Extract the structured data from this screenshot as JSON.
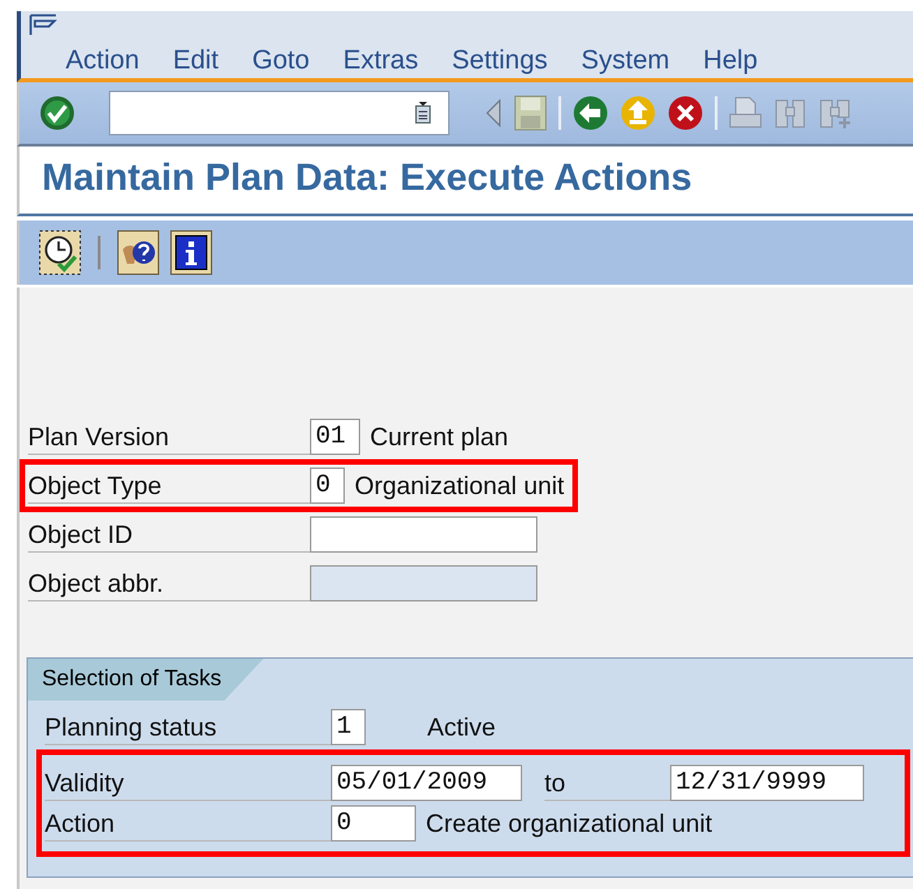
{
  "menu": [
    "Action",
    "Edit",
    "Goto",
    "Extras",
    "Settings",
    "System",
    "Help"
  ],
  "title": "Maintain Plan Data: Execute Actions",
  "fields": [
    {
      "label": "Plan Version",
      "kind": "code",
      "value": "01",
      "description": "Current plan",
      "highlighted": false
    },
    {
      "label": "Object Type",
      "kind": "code",
      "value": "0",
      "description": "Organizational unit",
      "highlighted": true
    },
    {
      "label": "Object ID",
      "kind": "text",
      "highlighted": false
    },
    {
      "label": "Object abbr.",
      "kind": "readonly",
      "highlighted": false
    }
  ],
  "tasks": {
    "title": "Selection of Tasks",
    "rows": [
      {
        "label": "Planning status",
        "kind": "code",
        "value": "1",
        "description": "Active",
        "highlighted": false
      },
      {
        "label": "Validity",
        "kind": "range",
        "value": "05/01/2009",
        "to_label": "to",
        "value_to": "12/31/9999",
        "highlighted": true
      },
      {
        "label": "Action",
        "kind": "code",
        "value": "0",
        "description": "Create organizational unit",
        "highlighted": true
      }
    ]
  }
}
